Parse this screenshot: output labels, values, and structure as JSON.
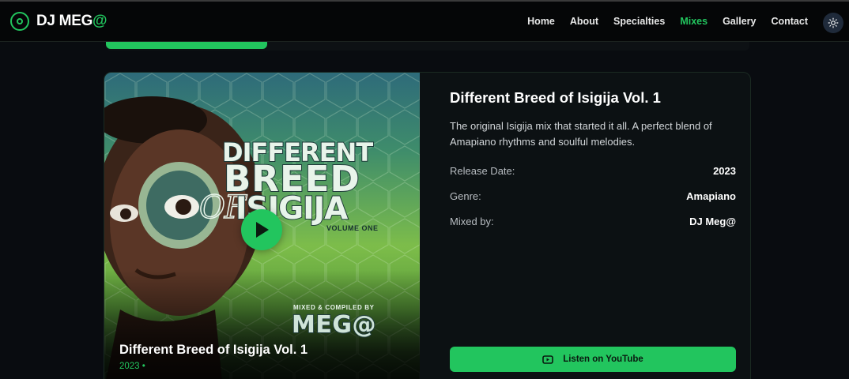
{
  "nav": {
    "brand_prefix": "DJ MEG",
    "brand_suffix": "@",
    "links": [
      {
        "label": "Home",
        "active": false
      },
      {
        "label": "About",
        "active": false
      },
      {
        "label": "Specialties",
        "active": false
      },
      {
        "label": "Mixes",
        "active": true
      },
      {
        "label": "Gallery",
        "active": false
      },
      {
        "label": "Contact",
        "active": false
      }
    ],
    "theme_toggle_icon": "sun-icon"
  },
  "colors": {
    "accent": "#22c55e",
    "background": "#090c10",
    "card_bg": "#0c1113"
  },
  "mix": {
    "cover_art": {
      "line1": "DIFFERENT",
      "line2": "BREED",
      "line3_prefix": "Of",
      "line3": "ISIGIJA",
      "volume": "VOLUME ONE",
      "mixed_by": "MIXED & COMPILED BY",
      "artist_logo": "MEG@"
    },
    "caption_title": "Different Breed of Isigija Vol. 1",
    "caption_year": "2023 •",
    "title": "Different Breed of Isigija Vol. 1",
    "description": "The original Isigija mix that started it all. A perfect blend of Amapiano rhythms and soulful melodies.",
    "meta": [
      {
        "label": "Release Date:",
        "value": "2023"
      },
      {
        "label": "Genre:",
        "value": "Amapiano"
      },
      {
        "label": "Mixed by:",
        "value": "DJ Meg@"
      }
    ],
    "youtube_button": "Listen on YouTube"
  }
}
